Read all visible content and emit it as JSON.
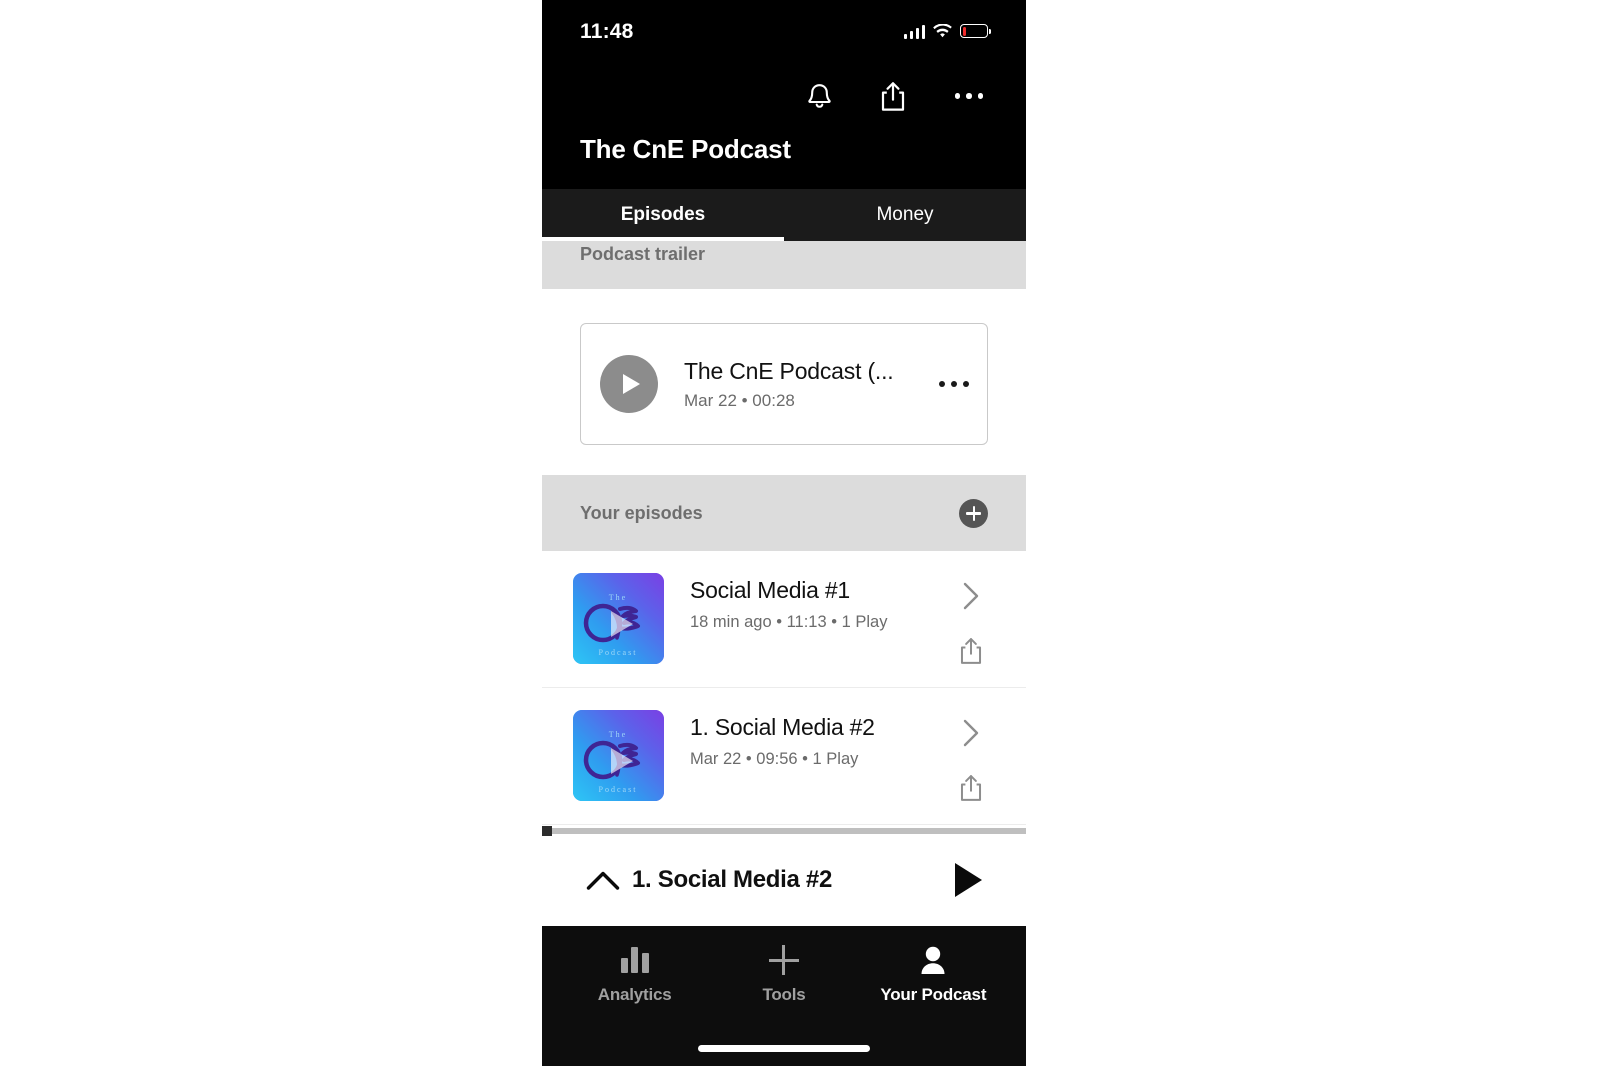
{
  "status_bar": {
    "time": "11:48",
    "signal_icon": "cellular-signal-icon",
    "wifi_icon": "wifi-icon",
    "battery_icon": "battery-low-icon",
    "battery_level_percent": 15,
    "battery_color": "#f02b2b"
  },
  "header": {
    "title": "The CnE Podcast",
    "icons": [
      {
        "name": "notifications-bell-icon",
        "label": "Notifications"
      },
      {
        "name": "share-icon",
        "label": "Share"
      },
      {
        "name": "more-options-icon",
        "label": "More options"
      }
    ]
  },
  "tabs": {
    "active_index": 0,
    "items": [
      {
        "label": "Episodes",
        "active": true
      },
      {
        "label": "Money",
        "active": false
      }
    ]
  },
  "sections": {
    "trailer": {
      "header_label": "Podcast trailer",
      "card": {
        "title": "The CnE Podcast (...",
        "meta": "Mar 22 • 00:28",
        "play_icon": "play-icon",
        "more_icon": "more-options-icon"
      }
    },
    "your_episodes": {
      "header_label": "Your episodes",
      "add_icon": "plus-circle-icon",
      "episodes": [
        {
          "title": "Social Media #1",
          "meta": "18 min ago • 11:13 • 1 Play",
          "artwork_alt": "The CnE Podcast artwork",
          "chevron_icon": "chevron-right-icon",
          "share_icon": "share-icon"
        },
        {
          "title": "1. Social Media #2",
          "meta": "Mar 22 • 09:56 • 1 Play",
          "artwork_alt": "The CnE Podcast artwork",
          "chevron_icon": "chevron-right-icon",
          "share_icon": "share-icon"
        }
      ]
    }
  },
  "mini_player": {
    "expand_icon": "chevron-up-icon",
    "title": "1. Social Media #2",
    "play_icon": "play-icon",
    "progress_percent": 1
  },
  "bottom_nav": {
    "active_index": 2,
    "items": [
      {
        "label": "Analytics",
        "icon": "bar-chart-icon",
        "active": false
      },
      {
        "label": "Tools",
        "icon": "plus-icon",
        "active": false
      },
      {
        "label": "Your Podcast",
        "icon": "person-icon",
        "active": true
      }
    ],
    "home_indicator": "home-indicator"
  },
  "colors": {
    "header_background": "#000000",
    "tabstrip_background": "#1b1b1b",
    "section_header_background": "#dcdcdc",
    "section_header_text": "#6e6e6e",
    "bottom_nav_background": "#0d0d0d",
    "nav_inactive": "#a0a0a0",
    "nav_active": "#ffffff",
    "artwork_gradient_start": "#2ec6f5",
    "artwork_gradient_end": "#7b3fe4",
    "artwork_logo": "#4b2a9e"
  }
}
